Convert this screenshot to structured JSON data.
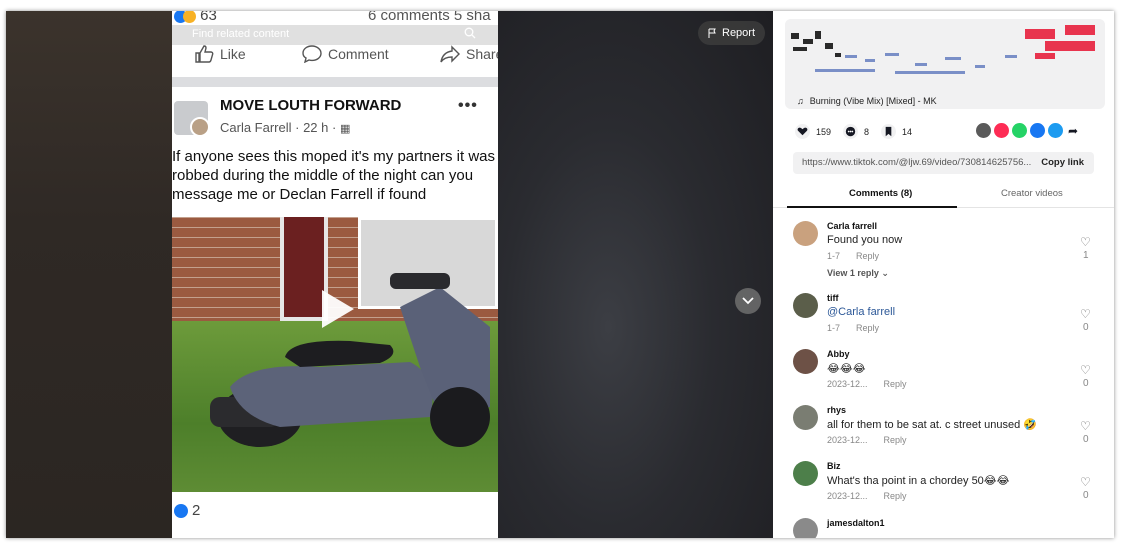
{
  "report_label": "Report",
  "video": {
    "top_reactions_count": "63",
    "top_comments_text": "6 comments  5 sha",
    "find_related": "Find related content",
    "actions": {
      "like": "Like",
      "comment": "Comment",
      "share": "Share"
    },
    "post": {
      "group_name": "MOVE LOUTH FORWARD",
      "author_line": "Carla Farrell · 22 h ·",
      "text": "If anyone sees this moped it's my partners it was\nrobbed during the middle of the night can you\nmessage me or Declan Farrell if found",
      "likes": "2"
    }
  },
  "panel": {
    "music": "Burning (Vibe Mix) [Mixed] - MK",
    "stats": {
      "likes": "159",
      "comments": "8",
      "saves": "14"
    },
    "share_colors": [
      "#5a5a5a",
      "#fe2c55",
      "#25d366",
      "#1877f2",
      "#1d9bf0"
    ],
    "link": "https://www.tiktok.com/@ljw.69/video/730814625756...",
    "copy_label": "Copy link",
    "tabs": {
      "comments": "Comments (8)",
      "creator": "Creator videos"
    },
    "comments": [
      {
        "name": "Carla farrell",
        "text": "Found you now",
        "date": "1-7",
        "reply": "Reply",
        "likes": "1",
        "view_replies": "View 1 reply ⌄",
        "avatar": "#c9a17e"
      },
      {
        "name": "tiff",
        "text": "@Carla farrell",
        "date": "1-7",
        "reply": "Reply",
        "likes": "0",
        "avatar": "#5b5e4a"
      },
      {
        "name": "Abby",
        "text": "😂😂😂",
        "date": "2023-12...",
        "reply": "Reply",
        "likes": "0",
        "avatar": "#6d5146"
      },
      {
        "name": "rhys",
        "text": "all for them to be sat at. c street unused 🤣",
        "date": "2023-12...",
        "reply": "Reply",
        "likes": "0",
        "avatar": "#7a7d72"
      },
      {
        "name": "Biz",
        "text": "What's tha point in a chordey 50😂😂",
        "date": "2023-12...",
        "reply": "Reply",
        "likes": "0",
        "avatar": "#4d7f4a"
      },
      {
        "name": "jamesdalton1",
        "text": "",
        "date": "",
        "reply": "",
        "likes": "",
        "avatar": "#8a8a8a"
      }
    ]
  }
}
